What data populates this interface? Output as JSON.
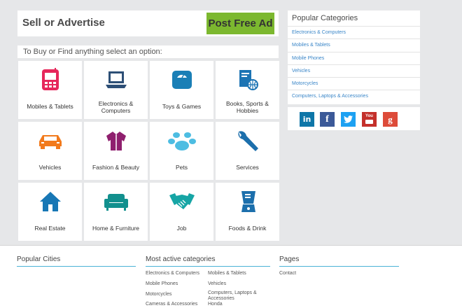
{
  "sell": {
    "title": "Sell or Advertise",
    "post_button": "Post Free Ad"
  },
  "prompt": "To Buy or Find anything select an option:",
  "categories": [
    {
      "label": "Mobiles & Tablets",
      "icon": "tablet-icon",
      "color": "#e6275b"
    },
    {
      "label": "Electronics & Computers",
      "icon": "laptop-icon",
      "color": "#2d4f76"
    },
    {
      "label": "Toys & Games",
      "icon": "scale-icon",
      "color": "#1a7fb6"
    },
    {
      "label": "Books, Sports & Hobbies",
      "icon": "book-ball-icon",
      "color": "#1c74b4"
    },
    {
      "label": "Vehicles",
      "icon": "car-icon",
      "color": "#f27a1c"
    },
    {
      "label": "Fashion & Beauty",
      "icon": "shirt-icon",
      "color": "#8f1f6e"
    },
    {
      "label": "Pets",
      "icon": "paw-icon",
      "color": "#4dbde2"
    },
    {
      "label": "Services",
      "icon": "wrench-icon",
      "color": "#1c6fac"
    },
    {
      "label": "Real Estate",
      "icon": "house-icon",
      "color": "#1777b5"
    },
    {
      "label": "Home & Furniture",
      "icon": "sofa-icon",
      "color": "#12908e"
    },
    {
      "label": "Job",
      "icon": "handshake-icon",
      "color": "#16a5a5"
    },
    {
      "label": "Foods & Drink",
      "icon": "blender-icon",
      "color": "#1c6fac"
    }
  ],
  "popular": {
    "title": "Popular Categories",
    "items": [
      "Electronics & Computers",
      "Mobiles & Tablets",
      "Mobile Phones",
      "Vehicles",
      "Motorcycles",
      "Computers, Laptops & Accessories"
    ]
  },
  "social": [
    {
      "label": "in",
      "icon": "linkedin-icon",
      "color": "#0e76a8"
    },
    {
      "label": "f",
      "icon": "facebook-icon",
      "color": "#3b5998"
    },
    {
      "label": "t",
      "icon": "twitter-icon",
      "color": "#1da1f2"
    },
    {
      "label": "You",
      "icon": "youtube-icon",
      "color": "#c4302b"
    },
    {
      "label": "g",
      "icon": "google-plus-icon",
      "color": "#dd4b39"
    }
  ],
  "footer": {
    "cities_title": "Popular Cities",
    "active_title": "Most active categories",
    "active_col1": [
      "Electronics & Computers",
      "Mobile Phones",
      "Motorcycles",
      "Cameras & Accessories"
    ],
    "active_col2": [
      "Mobiles & Tablets",
      "Vehicles",
      "Computers, Laptops & Accessories",
      "Honda"
    ],
    "pages_title": "Pages",
    "pages": [
      "Contact"
    ]
  }
}
